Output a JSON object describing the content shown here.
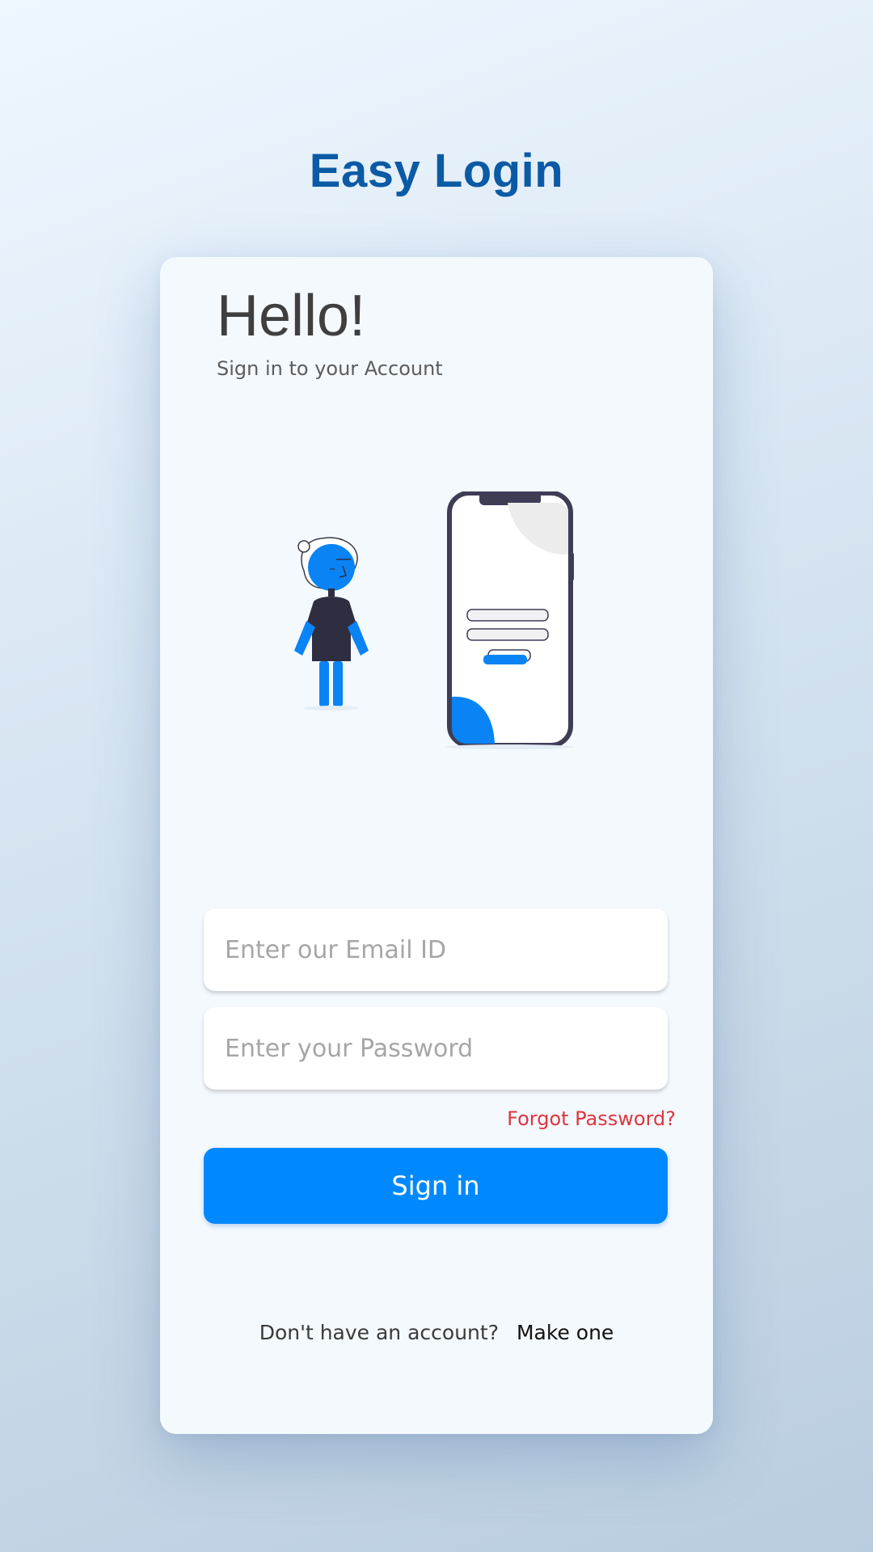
{
  "app": {
    "title": "Easy Login"
  },
  "card": {
    "greeting": "Hello!",
    "subtitle": "Sign in to your Account"
  },
  "form": {
    "email": {
      "value": "",
      "placeholder": "Enter our Email ID"
    },
    "password": {
      "value": "",
      "placeholder": "Enter your Password"
    },
    "forgot_label": "Forgot Password?",
    "signin_label": "Sign in"
  },
  "footer": {
    "prompt": "Don't have an account?",
    "link_label": "Make one"
  },
  "colors": {
    "brand_title": "#0b5aa5",
    "accent": "#0089fe",
    "forgot_link": "#e0353d",
    "card_background": "#f4f9fe"
  },
  "illustration": {
    "icons": [
      "person-figure-icon",
      "smartphone-icon"
    ]
  }
}
